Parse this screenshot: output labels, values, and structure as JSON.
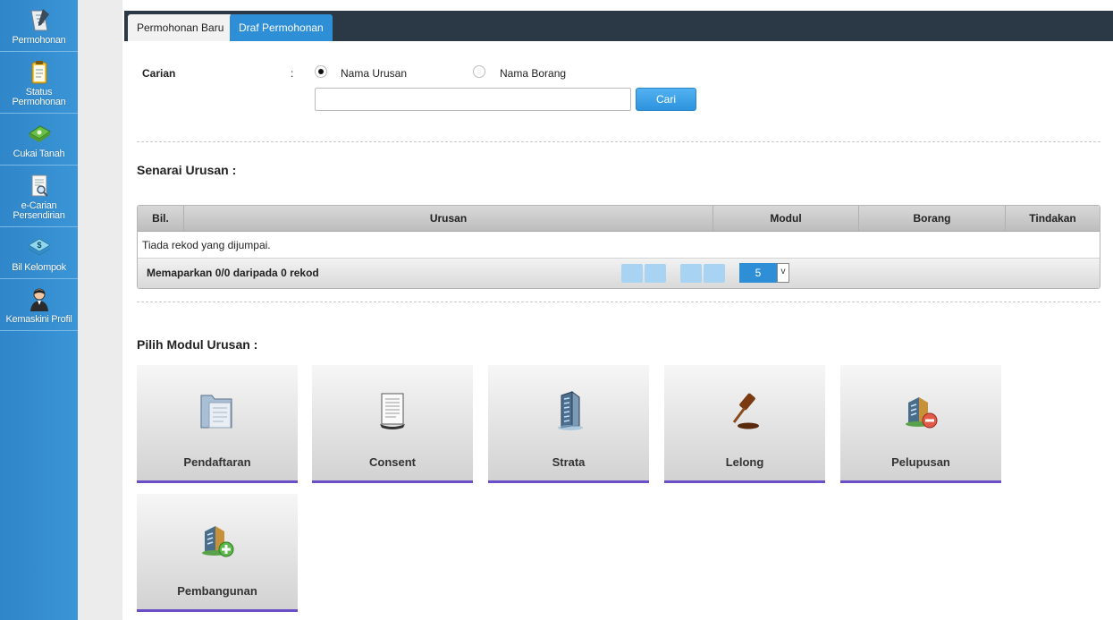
{
  "sidebar": {
    "items": [
      {
        "label": "Permohonan",
        "icon": "document-pen-icon"
      },
      {
        "label": "Status Permohonan",
        "icon": "clipboard-icon"
      },
      {
        "label": "Cukai Tanah",
        "icon": "cash-stack-icon"
      },
      {
        "label": "e-Carian Persendirian",
        "icon": "document-search-icon"
      },
      {
        "label": "Bil Kelompok",
        "icon": "money-icon"
      },
      {
        "label": "Kemaskini Profil",
        "icon": "user-icon"
      }
    ]
  },
  "tabs": {
    "active": "Permohonan Baru",
    "inactive": "Draf Permohonan"
  },
  "search": {
    "label": "Carian",
    "colon": ":",
    "option1": "Nama Urusan",
    "option2": "Nama Borang",
    "selected": "Nama Urusan",
    "input_value": "",
    "button": "Cari"
  },
  "list": {
    "heading": "Senarai Urusan :",
    "columns": [
      "Bil.",
      "Urusan",
      "Modul",
      "Borang",
      "Tindakan"
    ],
    "empty_text": "Tiada rekod yang dijumpai.",
    "footer_info": "Memaparkan 0/0 daripada 0 rekod",
    "page_size": "5",
    "page_size_arrow": "v"
  },
  "modules": {
    "heading": "Pilih Modul Urusan :",
    "items": [
      {
        "label": "Pendaftaran",
        "icon": "folder-icon"
      },
      {
        "label": "Consent",
        "icon": "document-icon"
      },
      {
        "label": "Strata",
        "icon": "building-icon"
      },
      {
        "label": "Lelong",
        "icon": "gavel-icon"
      },
      {
        "label": "Pelupusan",
        "icon": "building-remove-icon"
      },
      {
        "label": "Pembangunan",
        "icon": "building-add-icon"
      }
    ]
  },
  "colors": {
    "sidebar": "#2f86c9",
    "tabbar": "#2b3845",
    "accent": "#2e8fd6",
    "tile_border": "#6b4fc9"
  }
}
